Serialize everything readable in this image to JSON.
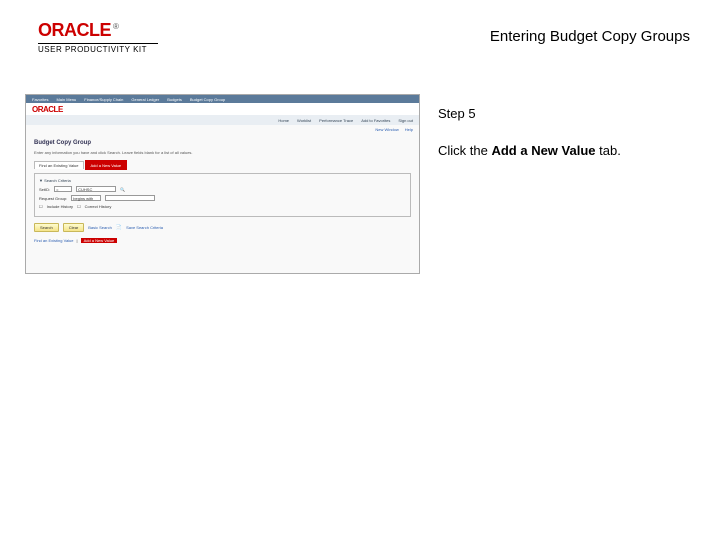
{
  "header": {
    "logo_text": "ORACLE",
    "logo_tm": "®",
    "upk_label": "USER PRODUCTIVITY KIT",
    "page_title": "Entering Budget Copy Groups"
  },
  "screenshot": {
    "oracle_logo": "ORACLE",
    "topnav": [
      "Favorites",
      "Main Menu",
      "Finance/Supply Chain",
      "General Ledger",
      "Budgets",
      "Budget Copy Group"
    ],
    "secondary_links": [
      "Home",
      "Worklist",
      "Performance Trace",
      "Add to Favorites",
      "Sign out"
    ],
    "new_window": "New Window",
    "help": "Help",
    "heading": "Budget Copy Group",
    "subtext": "Enter any information you have and click Search. Leave fields blank for a list of all values.",
    "tab_find": "Find an Existing Value",
    "tab_add": "Add a New Value",
    "panel_title": "Search Criteria",
    "field_setid_label": "SetID:",
    "field_setid_op": "=",
    "field_setid_value": "CUHSC",
    "field_group_label": "Request Group:",
    "field_group_op": "begins with",
    "chk_include": "Include History",
    "chk_correct": "Correct History",
    "btn_search": "Search",
    "btn_clear": "Clear",
    "link_basic": "Basic Search",
    "link_save": "Save Search Criteria",
    "foot_find": "Find an Existing Value",
    "foot_add": "Add a New Value"
  },
  "instructions": {
    "step_label": "Step 5",
    "line_prefix": "Click the ",
    "line_bold": "Add a New Value",
    "line_suffix": " tab."
  }
}
